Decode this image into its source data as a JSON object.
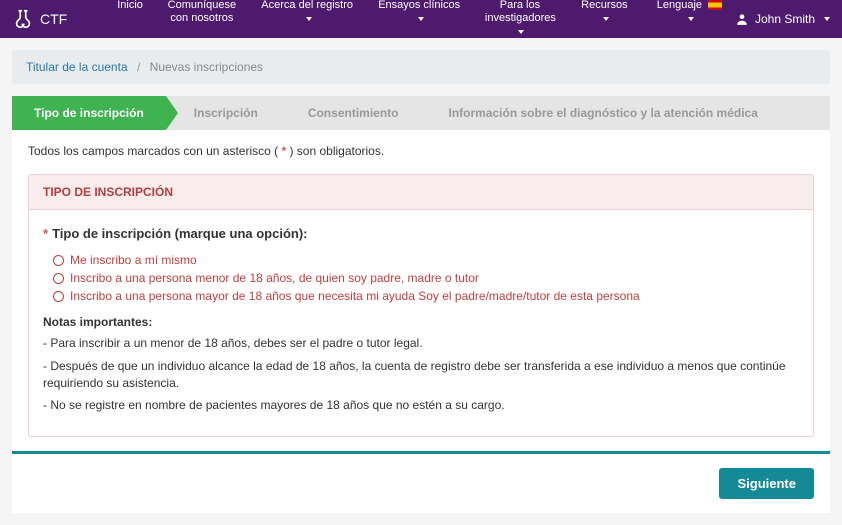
{
  "nav": {
    "brand": "CTF",
    "items": {
      "home": "Inicio",
      "contact": "Comuníquese con nosotros",
      "about": "Acerca del registro",
      "trials": "Ensayos clínicos",
      "researchers": "Para los investigadores",
      "resources": "Recursos",
      "language": "Lenguaje"
    },
    "user_name": "John Smith"
  },
  "breadcrumb": {
    "link": "Titular de la cuenta",
    "current": "Nuevas inscripciones"
  },
  "wizard": {
    "step1": "Tipo de inscripción",
    "step2": "Inscripción",
    "step3": "Consentimiento",
    "step4": "Información sobre el diagnóstico y la atención médica"
  },
  "form": {
    "required_prefix": "Todos los campos marcados con un asterisco ( ",
    "required_ast": "*",
    "required_suffix": " ) son obligatorios.",
    "section_title": "TIPO DE INSCRIPCIÓN",
    "question": "Tipo de inscripción (marque una opción):",
    "options": {
      "self": "Me inscribo a mí mismo",
      "minor": "Inscribo a una persona menor de 18 años, de quien soy padre, madre o tutor",
      "adult": "Inscribo a una persona mayor de 18 años que necesita mi ayuda Soy el padre/madre/tutor de esta persona"
    },
    "notes_title": "Notas importantes:",
    "note1": "- Para inscribir a un menor de 18 años, debes ser el padre o tutor legal.",
    "note2": "- Después de que un individuo alcance la edad de 18 años, la cuenta de registro debe ser transferida a ese individuo a menos que continúe requiriendo su asistencia.",
    "note3": "- No se registre en nombre de pacientes mayores de 18 años que no estén a su cargo."
  },
  "footer": {
    "next": "Siguiente"
  }
}
